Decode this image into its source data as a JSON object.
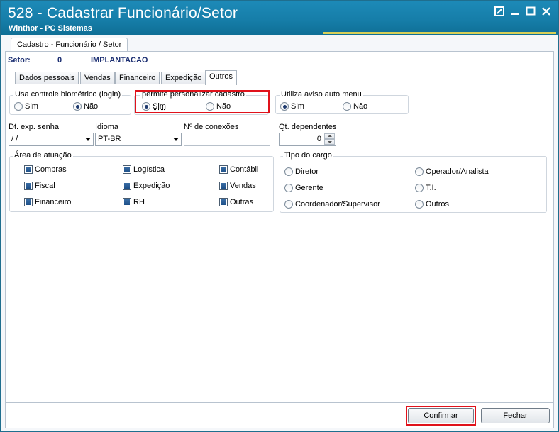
{
  "window": {
    "title": "528 - Cadastrar Funcionário/Setor",
    "subtitle": "Winthor - PC Sistemas"
  },
  "outer_tab": {
    "label": "Cadastro - Funcionário / Setor"
  },
  "setor": {
    "label": "Setor:",
    "code": "0",
    "name": "IMPLANTACAO"
  },
  "tabs": [
    {
      "label": "Dados pessoais",
      "active": false
    },
    {
      "label": "Vendas",
      "active": false
    },
    {
      "label": "Financeiro",
      "active": false
    },
    {
      "label": "Expedição",
      "active": false
    },
    {
      "label": "Outros",
      "active": true
    }
  ],
  "biometrico": {
    "legend": "Usa controle biométrico (login)",
    "options": [
      {
        "label": "Sim",
        "selected": false
      },
      {
        "label": "Não",
        "selected": true
      }
    ]
  },
  "personalizar": {
    "legend": "permite personalizar cadastro",
    "options": [
      {
        "label": "Sim",
        "selected": true
      },
      {
        "label": "Não",
        "selected": false
      }
    ]
  },
  "aviso_menu": {
    "legend": "Utiliza aviso auto menu",
    "options": [
      {
        "label": "Sim",
        "selected": true
      },
      {
        "label": "Não",
        "selected": false
      }
    ]
  },
  "dt_exp_senha": {
    "label": "Dt. exp. senha",
    "value": " /  /"
  },
  "idioma": {
    "label": "Idioma",
    "value": "PT-BR"
  },
  "nr_conexoes": {
    "label": "Nº de conexões",
    "value": ""
  },
  "qt_dependentes": {
    "label": "Qt. dependentes",
    "value": "0"
  },
  "area_atuacao": {
    "legend": "Área de atuação",
    "items": [
      {
        "label": "Compras",
        "checked": true
      },
      {
        "label": "Logística",
        "checked": true
      },
      {
        "label": "Contábil",
        "checked": true
      },
      {
        "label": "Fiscal",
        "checked": true
      },
      {
        "label": "Expedição",
        "checked": true
      },
      {
        "label": "Vendas",
        "checked": true
      },
      {
        "label": "Financeiro",
        "checked": true
      },
      {
        "label": "RH",
        "checked": true
      },
      {
        "label": "Outras",
        "checked": true
      }
    ]
  },
  "tipo_cargo": {
    "legend": "Tipo do cargo",
    "items": [
      {
        "label": "Diretor",
        "selected": false
      },
      {
        "label": "Operador/Analista",
        "selected": false
      },
      {
        "label": "Gerente",
        "selected": false
      },
      {
        "label": "T.I.",
        "selected": false
      },
      {
        "label": "Coordenador/Supervisor",
        "selected": false
      },
      {
        "label": "Outros",
        "selected": false
      }
    ]
  },
  "buttons": {
    "confirmar": "Confirmar",
    "fechar": "Fechar"
  },
  "colors": {
    "titlebar": "#167ea9",
    "highlight": "#e0121b",
    "setor_text": "#1c2f72"
  }
}
